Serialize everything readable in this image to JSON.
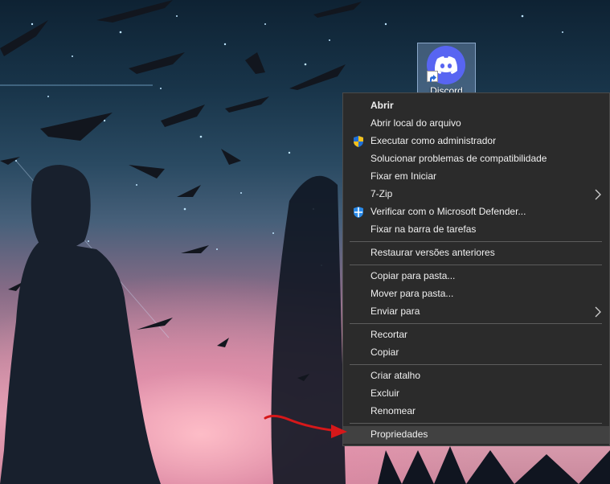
{
  "desktop": {
    "shortcut": {
      "label": "Discord",
      "icon": "discord-icon",
      "overlay_icon": "shortcut-arrow-icon"
    }
  },
  "context_menu": {
    "groups": [
      [
        {
          "label": "Abrir",
          "bold": true
        },
        {
          "label": "Abrir local do arquivo"
        },
        {
          "label": "Executar como administrador",
          "icon": "uac-shield-icon"
        },
        {
          "label": "Solucionar problemas de compatibilidade"
        },
        {
          "label": "Fixar em Iniciar"
        },
        {
          "label": "7-Zip",
          "submenu": true
        },
        {
          "label": "Verificar com o Microsoft Defender...",
          "icon": "defender-shield-icon"
        },
        {
          "label": "Fixar na barra de tarefas"
        }
      ],
      [
        {
          "label": "Restaurar versões anteriores"
        }
      ],
      [
        {
          "label": "Copiar para pasta..."
        },
        {
          "label": "Mover para pasta..."
        },
        {
          "label": "Enviar para",
          "submenu": true
        }
      ],
      [
        {
          "label": "Recortar"
        },
        {
          "label": "Copiar"
        }
      ],
      [
        {
          "label": "Criar atalho"
        },
        {
          "label": "Excluir"
        },
        {
          "label": "Renomear"
        }
      ],
      [
        {
          "label": "Propriedades",
          "highlighted": true
        }
      ]
    ]
  },
  "annotation": {
    "type": "arrow",
    "color": "#d6181a",
    "target": "Propriedades"
  },
  "colors": {
    "menu_bg": "#2b2b2b",
    "menu_text": "#f0f0f0",
    "highlight": "#414141",
    "separator": "#5c5c5c",
    "discord": "#5865f2"
  }
}
